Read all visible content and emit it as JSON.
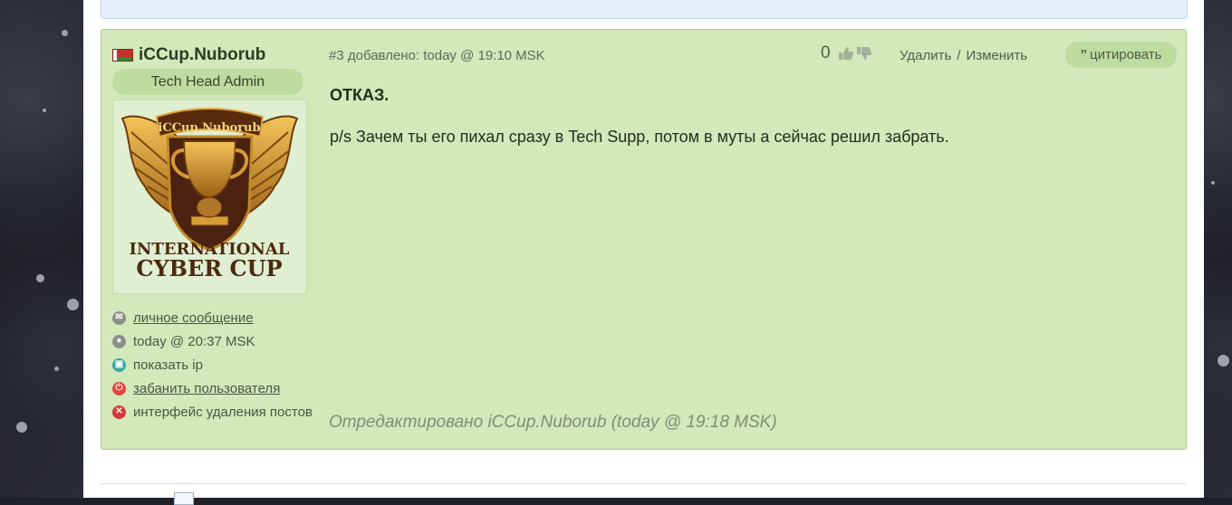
{
  "post": {
    "author": {
      "username": "iCCup.Nuborub",
      "rank": "Tech Head Admin",
      "avatar": {
        "top_text": "iCCup.Nuborub",
        "line1": "INTERNATIONAL",
        "line2": "CYBER CUP"
      },
      "links": [
        {
          "label": "личное сообщение",
          "icon": "mail-icon",
          "color": "#8a8f88"
        },
        {
          "label": "today @ 20:37 MSK",
          "icon": "clock-icon",
          "color": "#8a8f88"
        },
        {
          "label": "показать ip",
          "icon": "monitor-icon",
          "color": "#3aa5a0"
        },
        {
          "label": "забанить пользователя",
          "icon": "power-icon",
          "color": "#e0443b"
        },
        {
          "label": "интерфейс удаления постов",
          "icon": "delete-x-icon",
          "color": "#d7393a"
        }
      ]
    },
    "header": {
      "number_and_date": "#3 добавлено: today @ 19:10 MSK",
      "vote_count": "0",
      "delete_label": "Удалить",
      "separator": "/",
      "edit_label": "Изменить",
      "quote_symbol": "”",
      "quote_label": "цитировать"
    },
    "body": {
      "bold_line": "ОТКАЗ.",
      "text_line": "p/s Зачем ты его пихал сразу в Tech Supp, потом в муты а сейчас решил забрать."
    },
    "edited_note": "Отредактировано iCCup.Nuborub (today @ 19:18 MSK)"
  },
  "colors": {
    "post_bg": "#d3e8bb",
    "post_border": "#a9cf8a",
    "prev_post_bg": "#e6f0fb"
  }
}
